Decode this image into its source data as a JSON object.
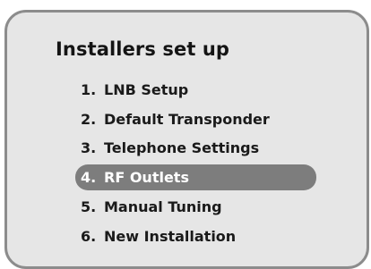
{
  "menu": {
    "title": "Installers set up",
    "items": [
      {
        "number": "1.",
        "label": "LNB Setup"
      },
      {
        "number": "2.",
        "label": "Default Transponder"
      },
      {
        "number": "3.",
        "label": "Telephone Settings"
      },
      {
        "number": "4.",
        "label": "RF Outlets",
        "selected": true
      },
      {
        "number": "5.",
        "label": "Manual Tuning"
      },
      {
        "number": "6.",
        "label": "New Installation"
      }
    ]
  },
  "colors": {
    "panel_background": "#e6e6e6",
    "panel_border": "#8c8c8c",
    "selected_background": "#7d7d7d",
    "selected_text": "#ffffff",
    "text": "#1a1a1a"
  }
}
